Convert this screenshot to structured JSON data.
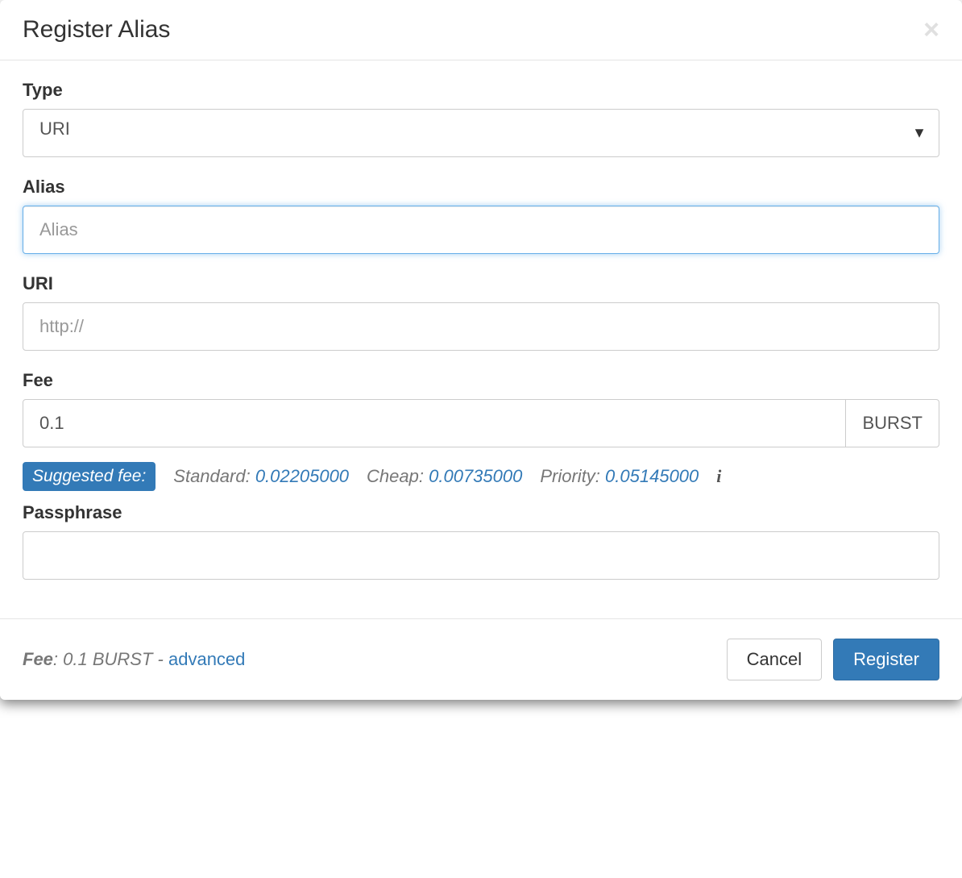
{
  "modal": {
    "title": "Register Alias"
  },
  "form": {
    "type": {
      "label": "Type",
      "value": "URI"
    },
    "alias": {
      "label": "Alias",
      "placeholder": "Alias",
      "value": ""
    },
    "uri": {
      "label": "URI",
      "placeholder": "http://",
      "value": ""
    },
    "fee": {
      "label": "Fee",
      "value": "0.1",
      "unit": "BURST",
      "suggest_label": "Suggested fee:",
      "standard_label": "Standard:",
      "standard_val": "0.02205000",
      "cheap_label": "Cheap:",
      "cheap_val": "0.00735000",
      "priority_label": "Priority:",
      "priority_val": "0.05145000"
    },
    "passphrase": {
      "label": "Passphrase",
      "value": ""
    }
  },
  "footer": {
    "fee_label": "Fee",
    "fee_sep": ": ",
    "fee_text": "0.1 BURST",
    "dash": " - ",
    "advanced": "advanced",
    "cancel": "Cancel",
    "register": "Register"
  }
}
